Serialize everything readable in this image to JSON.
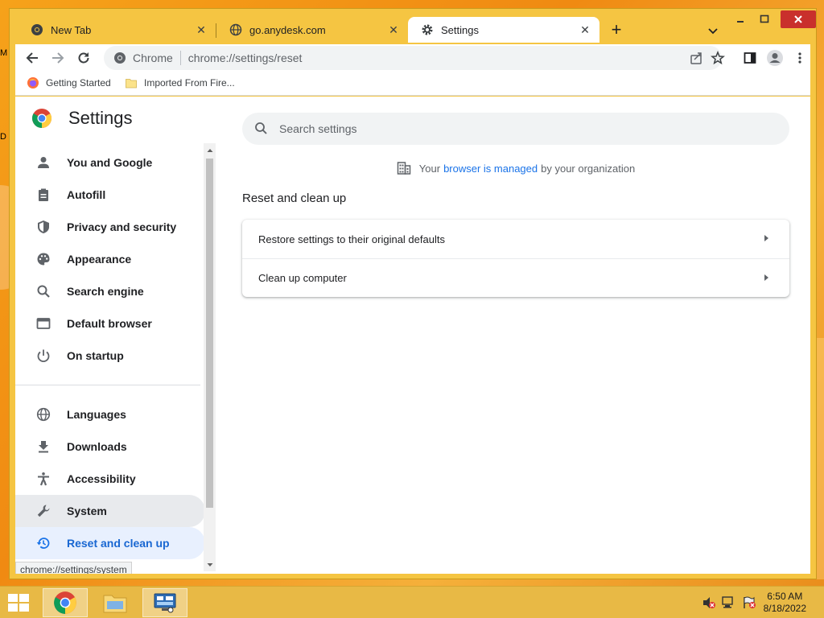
{
  "desktop": {
    "frag1": "M",
    "frag2": "D"
  },
  "tabs": [
    {
      "title": "New Tab",
      "icon": "chrome-icon"
    },
    {
      "title": "go.anydesk.com",
      "icon": "globe-icon"
    },
    {
      "title": "Settings",
      "icon": "gear-icon"
    }
  ],
  "omnibox": {
    "site_label": "Chrome",
    "url": "chrome://settings/reset"
  },
  "bookmarks": [
    {
      "label": "Getting Started",
      "icon": "firefox-icon"
    },
    {
      "label": "Imported From Fire...",
      "icon": "folder-icon"
    }
  ],
  "settings": {
    "title": "Settings",
    "search_placeholder": "Search settings",
    "managed_prefix": "Your",
    "managed_link": "browser is managed",
    "managed_suffix": "by your organization",
    "section_title": "Reset and clean up",
    "rows": [
      {
        "label": "Restore settings to their original defaults"
      },
      {
        "label": "Clean up computer"
      }
    ]
  },
  "nav": [
    {
      "label": "You and Google",
      "icon": "person-icon"
    },
    {
      "label": "Autofill",
      "icon": "clipboard-icon"
    },
    {
      "label": "Privacy and security",
      "icon": "shield-icon"
    },
    {
      "label": "Appearance",
      "icon": "palette-icon"
    },
    {
      "label": "Search engine",
      "icon": "search-icon"
    },
    {
      "label": "Default browser",
      "icon": "browser-window-icon"
    },
    {
      "label": "On startup",
      "icon": "power-icon"
    },
    {
      "label": "Languages",
      "icon": "globe-icon"
    },
    {
      "label": "Downloads",
      "icon": "download-icon"
    },
    {
      "label": "Accessibility",
      "icon": "accessibility-icon"
    },
    {
      "label": "System",
      "icon": "wrench-icon"
    },
    {
      "label": "Reset and clean up",
      "icon": "history-icon"
    }
  ],
  "status_url": "chrome://settings/system",
  "taskbar": {
    "time": "6:50 AM",
    "date": "8/18/2022"
  },
  "colors": {
    "accent": "#1a73e8",
    "selected_bg": "#e8f0fe",
    "frame": "#f5c542"
  }
}
